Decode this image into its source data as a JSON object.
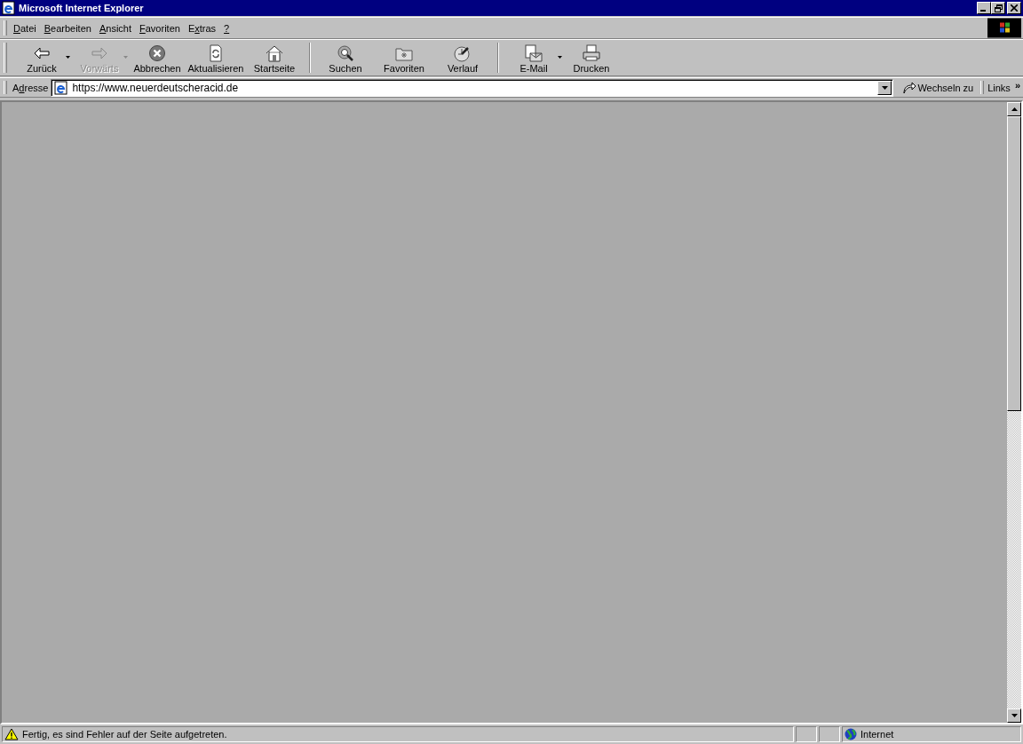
{
  "window": {
    "title": "Microsoft Internet Explorer"
  },
  "menu": [
    {
      "key": "D",
      "after": "atei"
    },
    {
      "key": "B",
      "after": "earbeiten"
    },
    {
      "key": "A",
      "after": "nsicht"
    },
    {
      "key": "F",
      "after": "avoriten"
    },
    {
      "before": "E",
      "key": "x",
      "after": "tras"
    },
    {
      "key": "?"
    }
  ],
  "toolbar": [
    [
      {
        "kind": "back",
        "label": "Zurück",
        "disabled": false,
        "dropdown": true
      },
      {
        "kind": "forward",
        "label": "Vorwärts",
        "disabled": true,
        "dropdown": true
      },
      {
        "kind": "stop",
        "label": "Abbrechen",
        "disabled": false,
        "dropdown": false
      },
      {
        "kind": "refresh",
        "label": "Aktualisieren",
        "disabled": false,
        "dropdown": false
      },
      {
        "kind": "home",
        "label": "Startseite",
        "disabled": false,
        "dropdown": false
      }
    ],
    [
      {
        "kind": "search",
        "label": "Suchen",
        "disabled": false,
        "dropdown": false
      },
      {
        "kind": "favorites",
        "label": "Favoriten",
        "disabled": false,
        "dropdown": false
      },
      {
        "kind": "history",
        "label": "Verlauf",
        "disabled": false,
        "dropdown": false
      }
    ],
    [
      {
        "kind": "mail",
        "label": "E-Mail",
        "disabled": false,
        "dropdown": true
      },
      {
        "kind": "print",
        "label": "Drucken",
        "disabled": false,
        "dropdown": false
      }
    ]
  ],
  "address": {
    "label_before": "A",
    "label_key": "d",
    "label_after": "resse",
    "value": "https://www.neuerdeutscheracid.de",
    "go": "Wechseln zu",
    "links": "Links",
    "more": "»"
  },
  "status_bar": {
    "message": "Fertig, es sind Fehler auf der Seite aufgetreten.",
    "zone": "Internet"
  }
}
